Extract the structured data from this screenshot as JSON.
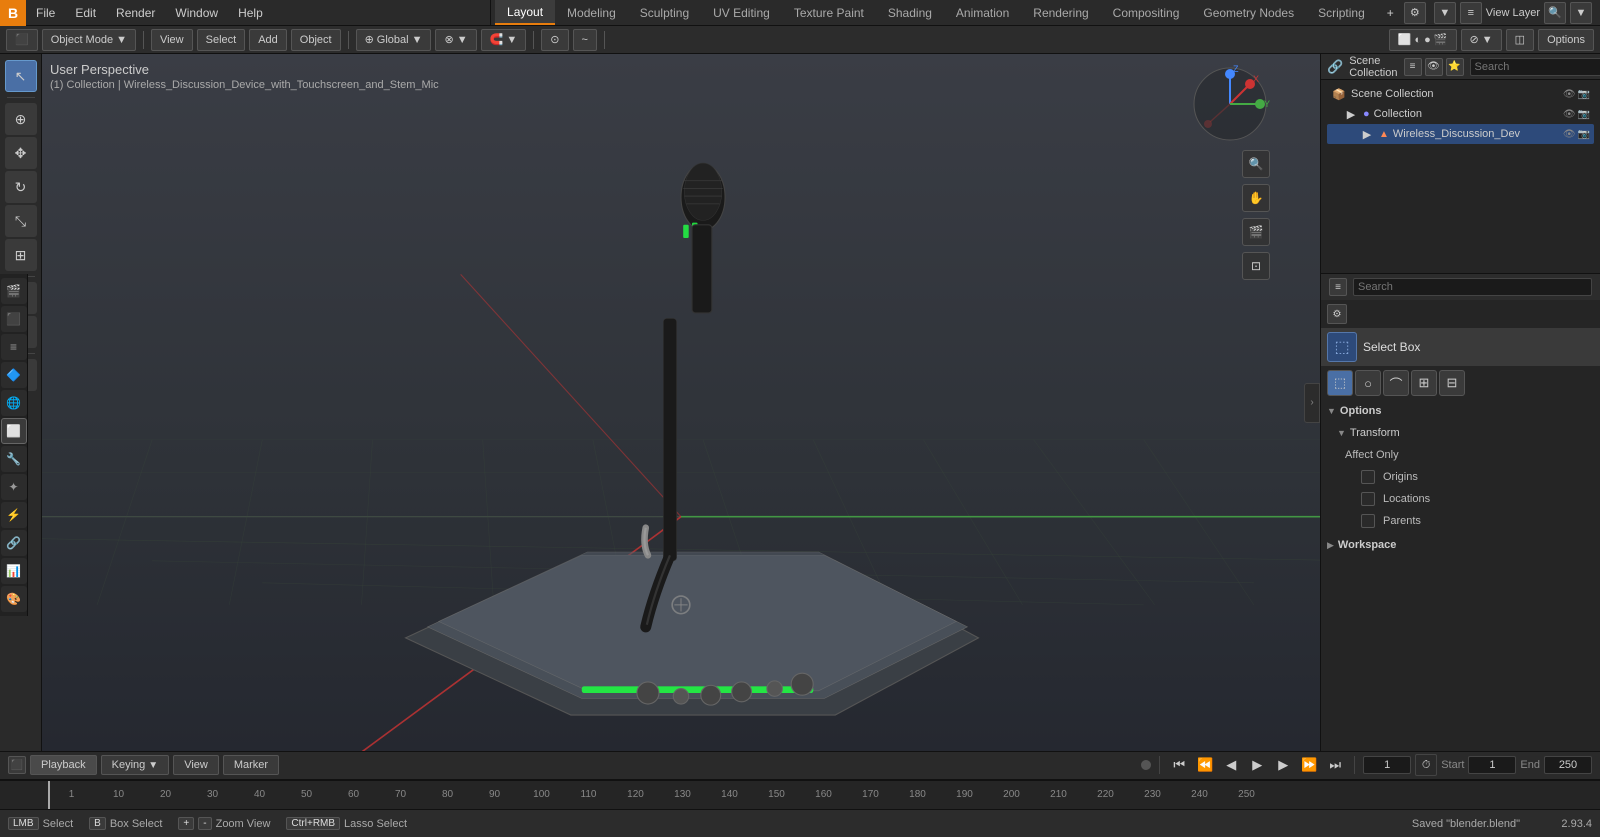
{
  "app": {
    "title": "Blender",
    "logo": "B"
  },
  "topmenu": {
    "items": [
      {
        "id": "file",
        "label": "File"
      },
      {
        "id": "edit",
        "label": "Edit"
      },
      {
        "id": "render",
        "label": "Render"
      },
      {
        "id": "window",
        "label": "Window"
      },
      {
        "id": "help",
        "label": "Help"
      }
    ]
  },
  "workspace_tabs": [
    {
      "id": "layout",
      "label": "Layout",
      "active": true
    },
    {
      "id": "modeling",
      "label": "Modeling"
    },
    {
      "id": "sculpting",
      "label": "Sculpting"
    },
    {
      "id": "uv_editing",
      "label": "UV Editing"
    },
    {
      "id": "texture_paint",
      "label": "Texture Paint"
    },
    {
      "id": "shading",
      "label": "Shading"
    },
    {
      "id": "animation",
      "label": "Animation"
    },
    {
      "id": "rendering",
      "label": "Rendering"
    },
    {
      "id": "compositing",
      "label": "Compositing"
    },
    {
      "id": "geometry_nodes",
      "label": "Geometry Nodes"
    },
    {
      "id": "scripting",
      "label": "Scripting"
    }
  ],
  "toolbar2": {
    "mode_label": "Object Mode",
    "view_label": "View",
    "select_label": "Select",
    "add_label": "Add",
    "object_label": "Object",
    "transform_label": "Global",
    "snap_label": "Snap",
    "options_label": "Options"
  },
  "viewport": {
    "perspective": "User Perspective",
    "collection_info": "(1) Collection | Wireless_Discussion_Device_with_Touchscreen_and_Stem_Mic"
  },
  "outliner": {
    "title": "Scene Collection",
    "items": [
      {
        "id": "collection",
        "label": "Collection",
        "icon": "📁",
        "indent": 0
      },
      {
        "id": "wireless_device",
        "label": "Wireless_Discussion_Dev",
        "icon": "▶",
        "indent": 1
      }
    ]
  },
  "tools_panel": {
    "search_placeholder": "Search",
    "select_box_label": "Select Box",
    "options_section": {
      "label": "Options",
      "transform_section": {
        "label": "Transform",
        "affect_only_label": "Affect Only",
        "origins_label": "Origins",
        "locations_label": "Locations",
        "parents_label": "Parents"
      }
    },
    "workspace_label": "Workspace"
  },
  "timeline": {
    "playback_label": "Playback",
    "keying_label": "Keying",
    "view_label": "View",
    "marker_label": "Marker",
    "frame_current": "1",
    "frame_start_label": "Start",
    "frame_start": "1",
    "frame_end_label": "End",
    "frame_end": "250",
    "frame_numbers": [
      "1",
      "10",
      "20",
      "30",
      "40",
      "50",
      "60",
      "70",
      "80",
      "90",
      "100",
      "110",
      "120",
      "130",
      "140",
      "150",
      "160",
      "170",
      "180",
      "190",
      "200",
      "210",
      "220",
      "230",
      "240",
      "250"
    ]
  },
  "status_bar": {
    "select_key": "Select",
    "box_select_key": "Box Select",
    "zoom_view_key": "Zoom View",
    "lasso_select_key": "Lasso Select",
    "saved_msg": "Saved \"blender.blend\"",
    "coords": "2.93.4"
  },
  "colors": {
    "accent_orange": "#e87d0d",
    "active_blue": "#4a6fa5",
    "bg_dark": "#252525",
    "bg_mid": "#2c2c2c",
    "bg_light": "#3a3a3a",
    "text_normal": "#cccccc",
    "text_dim": "#888888",
    "grid_line": "#444444",
    "axis_x": "#aa3333",
    "axis_y": "#44aa44"
  }
}
